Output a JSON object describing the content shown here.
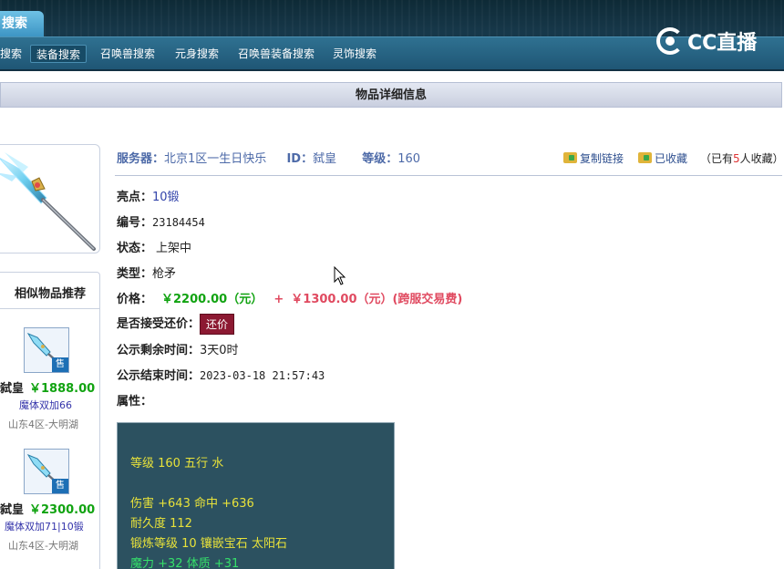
{
  "nav": {
    "main_tab": "搜索",
    "items": [
      {
        "label": "搜索"
      },
      {
        "label": "装备搜索"
      },
      {
        "label": "召唤兽搜索"
      },
      {
        "label": "元身搜索"
      },
      {
        "label": "召唤兽装备搜索"
      },
      {
        "label": "灵饰搜索"
      }
    ],
    "logo_text": "CC直播"
  },
  "section_title": "物品详细信息",
  "info": {
    "server_label": "服务器：",
    "server_value": "北京1区一生日快乐",
    "id_label": "ID：",
    "id_value": "弑皇",
    "level_label": "等级：",
    "level_value": "160",
    "copy_link": "复制链接",
    "favorited": "已收藏",
    "fav_count_pre": "（已有",
    "fav_count": "5",
    "fav_count_post": "人收藏）"
  },
  "details": {
    "highlight_label": "亮点：",
    "highlight_value": "10锻",
    "number_label": "编号：",
    "number_value": "23184454",
    "status_label": "状态：",
    "status_value": "上架中",
    "type_label": "类型：",
    "type_value": "枪矛",
    "price_label": "价格：",
    "price_main": "￥2200.00（元）",
    "price_plus": "+",
    "price_fee": "￥1300.00（元）(跨服交易费)",
    "counter_label": "是否接受还价：",
    "counter_button": "还价",
    "remaining_label": "公示剩余时间：",
    "remaining_value": "3天0时",
    "end_label": "公示结束时间：",
    "end_value": "2023-03-18 21:57:43",
    "attr_label": "属性："
  },
  "attributes": {
    "line1": "等级 160 五行 水",
    "line2": "伤害 +643 命中 +636",
    "line3": "耐久度 112",
    "line4": "锻炼等级 10 镶嵌宝石 太阳石",
    "line5": "魔力 +32 体质 +31"
  },
  "similar": {
    "title": "相似物品推荐",
    "sell_tag": "售",
    "items": [
      {
        "name": "弑皇",
        "price": "￥1888.00",
        "attr": "魔体双加66",
        "server": "山东4区-大明湖"
      },
      {
        "name": "弑皇",
        "price": "￥2300.00",
        "attr": "魔体双加71|10锻",
        "server": "山东4区-大明湖"
      }
    ]
  },
  "colors": {
    "nav_bg": "#1f5675",
    "price_green": "#11a311",
    "price_red": "#e04a60",
    "attr_box_bg": "#2c5160",
    "attr_text": "#e8e23a",
    "attr_text_green": "#35e06a",
    "counter_button": "#8c1932"
  },
  "icons": [
    "folder-copy-icon",
    "folder-fav-icon",
    "cc-logo-icon",
    "mouse-cursor-icon",
    "spear-weapon-icon"
  ]
}
